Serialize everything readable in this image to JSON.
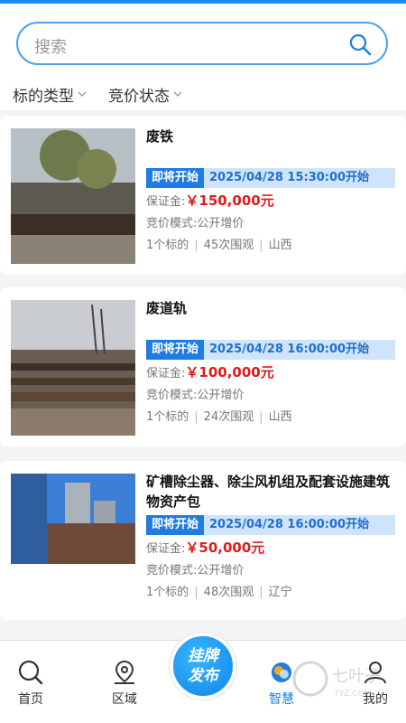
{
  "search": {
    "placeholder": "搜索"
  },
  "filters": [
    {
      "label": "标的类型"
    },
    {
      "label": "竞价状态"
    }
  ],
  "listings": [
    {
      "title": "废铁",
      "status": "即将开始",
      "start": "2025/04/28 15:30:00开始",
      "deposit_label": "保证金:",
      "deposit": "￥150,000元",
      "mode_label": "竞价模式:",
      "mode": "公开增价",
      "count": "1个标的",
      "views": "45次围观",
      "region": "山西"
    },
    {
      "title": "废道轨",
      "status": "即将开始",
      "start": "2025/04/28 16:00:00开始",
      "deposit_label": "保证金:",
      "deposit": "￥100,000元",
      "mode_label": "竞价模式:",
      "mode": "公开增价",
      "count": "1个标的",
      "views": "24次围观",
      "region": "山西"
    },
    {
      "title": "矿槽除尘器、除尘风机组及配套设施建筑物资产包",
      "status": "即将开始",
      "start": "2025/04/28 16:00:00开始",
      "deposit_label": "保证金:",
      "deposit": "￥50,000元",
      "mode_label": "竞价模式:",
      "mode": "公开增价",
      "count": "1个标的",
      "views": "48次围观",
      "region": "辽宁"
    }
  ],
  "tabbar": {
    "home": "首页",
    "region": "区域",
    "publish_line1": "挂牌",
    "publish_line2": "发布",
    "smart": "智慧",
    "mine": "我的"
  },
  "watermark": "七叶子",
  "watermark_sub": "7YZ.COM",
  "colors": {
    "accent": "#1e7de2",
    "price": "#e01b1b"
  }
}
